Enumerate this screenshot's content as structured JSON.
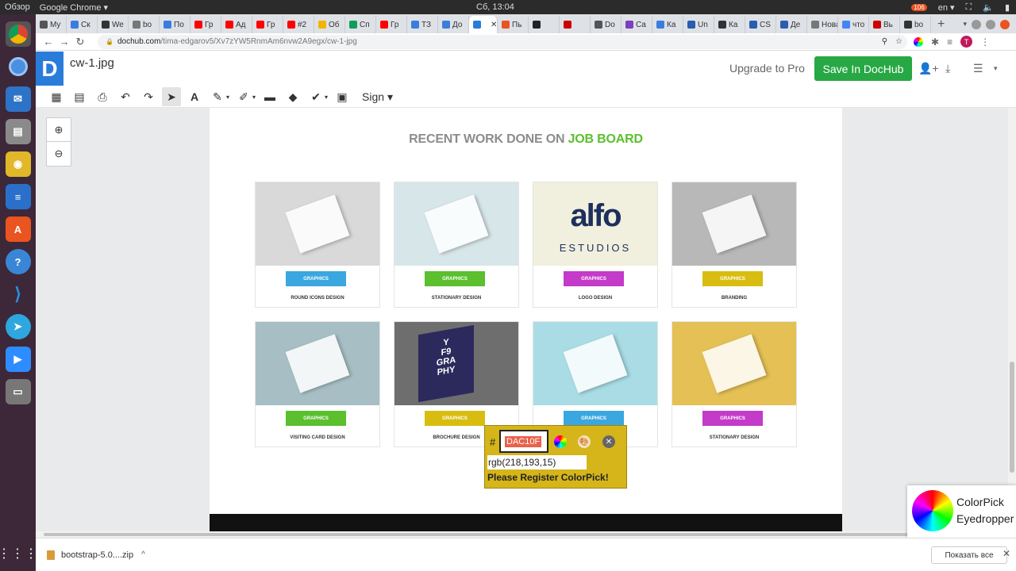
{
  "os_bar": {
    "activities": "Обзор",
    "app_name": "Google Chrome ▾",
    "clock": "Сб, 13:04",
    "badge": "106",
    "lang": "en ▾"
  },
  "tabs": [
    {
      "label": "My",
      "color": "#555"
    },
    {
      "label": "Ск",
      "color": "#3b7ddd"
    },
    {
      "label": "We",
      "color": "#333"
    },
    {
      "label": "bo",
      "color": "#777"
    },
    {
      "label": "По",
      "color": "#3b7ddd"
    },
    {
      "label": "Гр",
      "color": "#ff0000"
    },
    {
      "label": "Ад",
      "color": "#ff0000"
    },
    {
      "label": "Гр",
      "color": "#ff0000"
    },
    {
      "label": "#2",
      "color": "#ff0000"
    },
    {
      "label": "Об",
      "color": "#f4b400"
    },
    {
      "label": "Сп",
      "color": "#0f9d58"
    },
    {
      "label": "Гр",
      "color": "#ff0000"
    },
    {
      "label": "ТЗ",
      "color": "#3b7ddd"
    },
    {
      "label": "До",
      "color": "#3b7ddd"
    },
    {
      "label": "",
      "color": "#2a7cdb",
      "active": true
    },
    {
      "label": "Пь",
      "color": "#e95420"
    },
    {
      "label": "",
      "color": "#222"
    },
    {
      "label": "",
      "color": "#c00"
    },
    {
      "label": "Do",
      "color": "#555"
    },
    {
      "label": "Ca",
      "color": "#7b3fbf"
    },
    {
      "label": "Ка",
      "color": "#3b7ddd"
    },
    {
      "label": "Un",
      "color": "#2a5db0"
    },
    {
      "label": "Ка",
      "color": "#333"
    },
    {
      "label": "CS",
      "color": "#2a5db0"
    },
    {
      "label": "Де",
      "color": "#2a5db0"
    },
    {
      "label": "Нова",
      "color": "#777"
    },
    {
      "label": "что",
      "color": "#4285f4"
    },
    {
      "label": "Вь",
      "color": "#c00"
    },
    {
      "label": "bo",
      "color": "#333"
    }
  ],
  "address": {
    "host": "dochub.com",
    "path": "/tima-edgarov5/Xv7zYW5RnmAm6nvw2A9egx/cw-1-jpg",
    "profile_initial": "T"
  },
  "header": {
    "logo_letter": "D",
    "doc_title": "cw-1.jpg",
    "upgrade_label": "Upgrade to Pro",
    "save_label": "Save In DocHub"
  },
  "toolbar": {
    "sign_label": "Sign"
  },
  "document": {
    "heading_prefix": "RECENT WORK DONE ON ",
    "heading_highlight": "JOB BOARD",
    "cards": [
      {
        "tag": "GRAPHICS",
        "title": "ROUND ICONS DESIGN",
        "tag_color": "#3aa7e0",
        "thumb_color": "#d9d9d9"
      },
      {
        "tag": "GRAPHICS",
        "title": "STATIONARY DESIGN",
        "tag_color": "#5bbf2e",
        "thumb_color": "#d7e6e9"
      },
      {
        "tag": "GRAPHICS",
        "title": "LOGO DESIGN",
        "tag_color": "#c43ac9",
        "thumb_color": "#f1efde"
      },
      {
        "tag": "GRAPHICS",
        "title": "BRANDING",
        "tag_color": "#d8bd10",
        "thumb_color": "#b8b8b8"
      },
      {
        "tag": "GRAPHICS",
        "title": "VISITING CARD DESIGN",
        "tag_color": "#5bbf2e",
        "thumb_color": "#a7bfc4"
      },
      {
        "tag": "GRAPHICS",
        "title": "BROCHURE DESIGN",
        "tag_color": "#d8bd10",
        "thumb_color": "#6e6e6e"
      },
      {
        "tag": "GRAPHICS",
        "title": "",
        "tag_color": "#3aa7e0",
        "thumb_color": "#a9dce4"
      },
      {
        "tag": "GRAPHICS",
        "title": "STATIONARY DESIGN",
        "tag_color": "#c43ac9",
        "thumb_color": "#e4c055"
      }
    ],
    "logo_text": "alfo",
    "logo_sub": "ESTUDIOS",
    "brochure_text": "Y\nF9\nGRA\nPHY"
  },
  "colorpick": {
    "hash": "#",
    "hex": "DAC10F",
    "rgb": "rgb(218,193,15)",
    "notice": "Please Register ColorPick!"
  },
  "colorpick_popup": {
    "line1": "ColorPick",
    "line2": "Eyedropper"
  },
  "downloads": {
    "filename": "bootstrap-5.0....zip",
    "show_all": "Показать все"
  }
}
